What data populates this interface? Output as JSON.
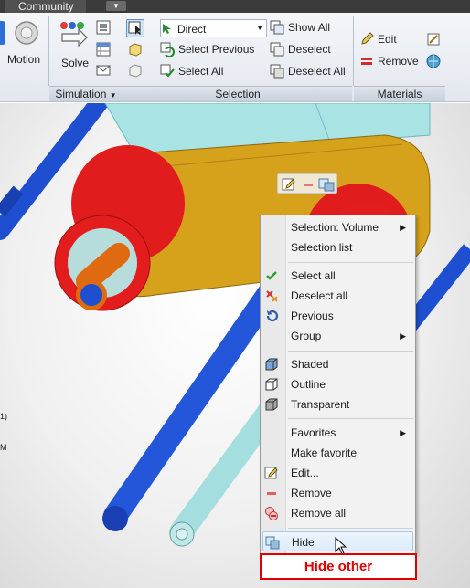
{
  "tabbar": {
    "active_tab": "Community"
  },
  "ribbon": {
    "motion_label": "Motion",
    "solve_label": "Solve",
    "simulation_panel": "Simulation",
    "selection_panel": "Selection",
    "materials_panel": "Materials",
    "select_mode": "Direct",
    "select_previous": "Select Previous",
    "select_all": "Select All",
    "show_all": "Show All",
    "deselect": "Deselect",
    "deselect_all": "Deselect All",
    "edit": "Edit",
    "remove": "Remove"
  },
  "viewport": {
    "side_text_1": "1)",
    "side_text_2": "M"
  },
  "context_menu": {
    "items": [
      {
        "label": "Selection: Volume"
      },
      {
        "label": "Selection list"
      },
      {
        "label": "Select all"
      },
      {
        "label": "Deselect all"
      },
      {
        "label": "Previous"
      },
      {
        "label": "Group"
      },
      {
        "label": "Shaded"
      },
      {
        "label": "Outline"
      },
      {
        "label": "Transparent"
      },
      {
        "label": "Favorites"
      },
      {
        "label": "Make favorite"
      },
      {
        "label": "Edit..."
      },
      {
        "label": "Remove"
      },
      {
        "label": "Remove all"
      },
      {
        "label": "Hide"
      }
    ]
  },
  "callout": {
    "label": "Hide other",
    "color": "#e00000"
  },
  "colors": {
    "accent": "#e00000",
    "ribbon_bg": "#e8ecf2",
    "menu_bg": "#f2f2f2"
  }
}
